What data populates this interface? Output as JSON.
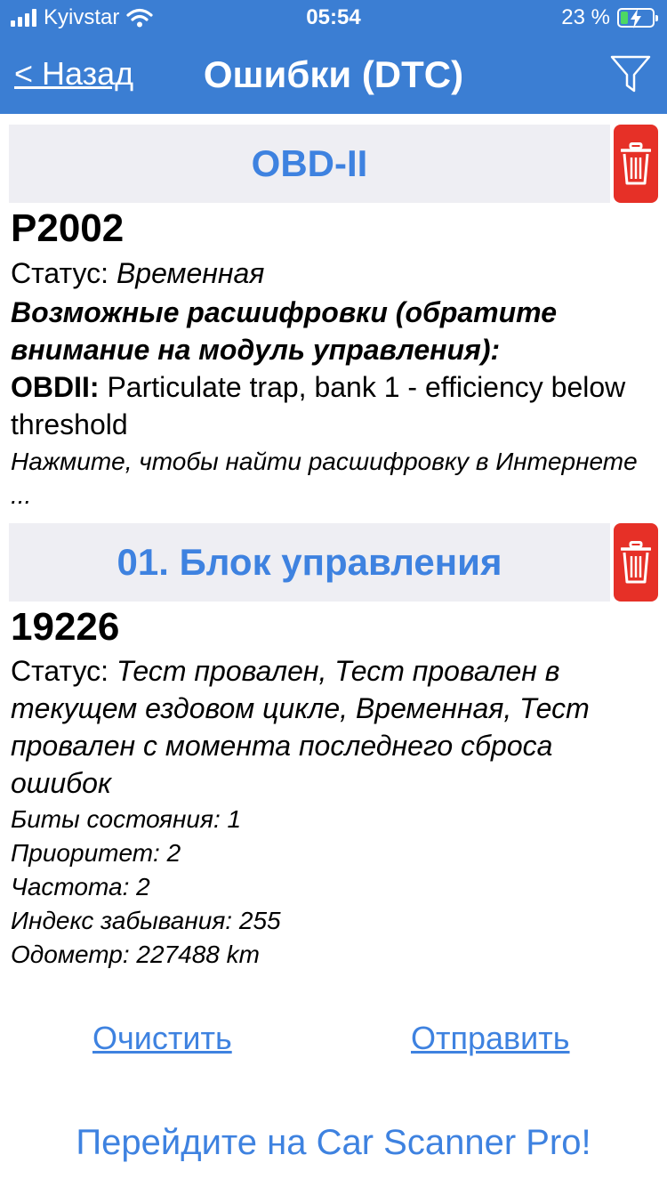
{
  "status_bar": {
    "carrier": "Kyivstar",
    "time": "05:54",
    "battery_percent": "23 %",
    "battery_level": 0.23,
    "charging": true
  },
  "nav": {
    "back_label": "< Назад",
    "title": "Ошибки (DTC)",
    "filter_icon": "filter-funnel-icon"
  },
  "sections": [
    {
      "header": "OBD-II",
      "code": "P2002",
      "status_label": "Статус: ",
      "status_value": "Временная",
      "possible_label": "Возможные расшифровки (обратите внимание на модуль управления):",
      "decode_prefix": "OBDII:",
      "decode_text": " Particulate trap, bank 1 - efficiency below threshold",
      "search_hint": "Нажмите, чтобы найти расшифровку в Интернете ..."
    },
    {
      "header": "01. Блок управления",
      "code": "19226",
      "status_label": "Статус: ",
      "status_value": "Тест провален, Тест провален в текущем ездовом цикле, Временная, Тест провален с момента последнего сброса ошибок",
      "details": [
        "Биты состояния: 1",
        "Приоритет: 2",
        "Частота: 2",
        "Индекс забывания: 255",
        "Одометр: 227488 km"
      ]
    }
  ],
  "actions": {
    "clear_label": "Очистить",
    "send_label": "Отправить"
  },
  "promo": "Перейдите на Car Scanner Pro!",
  "colors": {
    "bar_blue": "#3b7ed3",
    "link_blue": "#3e82e0",
    "trash_red": "#e63027",
    "header_gray": "#eeeef3"
  }
}
